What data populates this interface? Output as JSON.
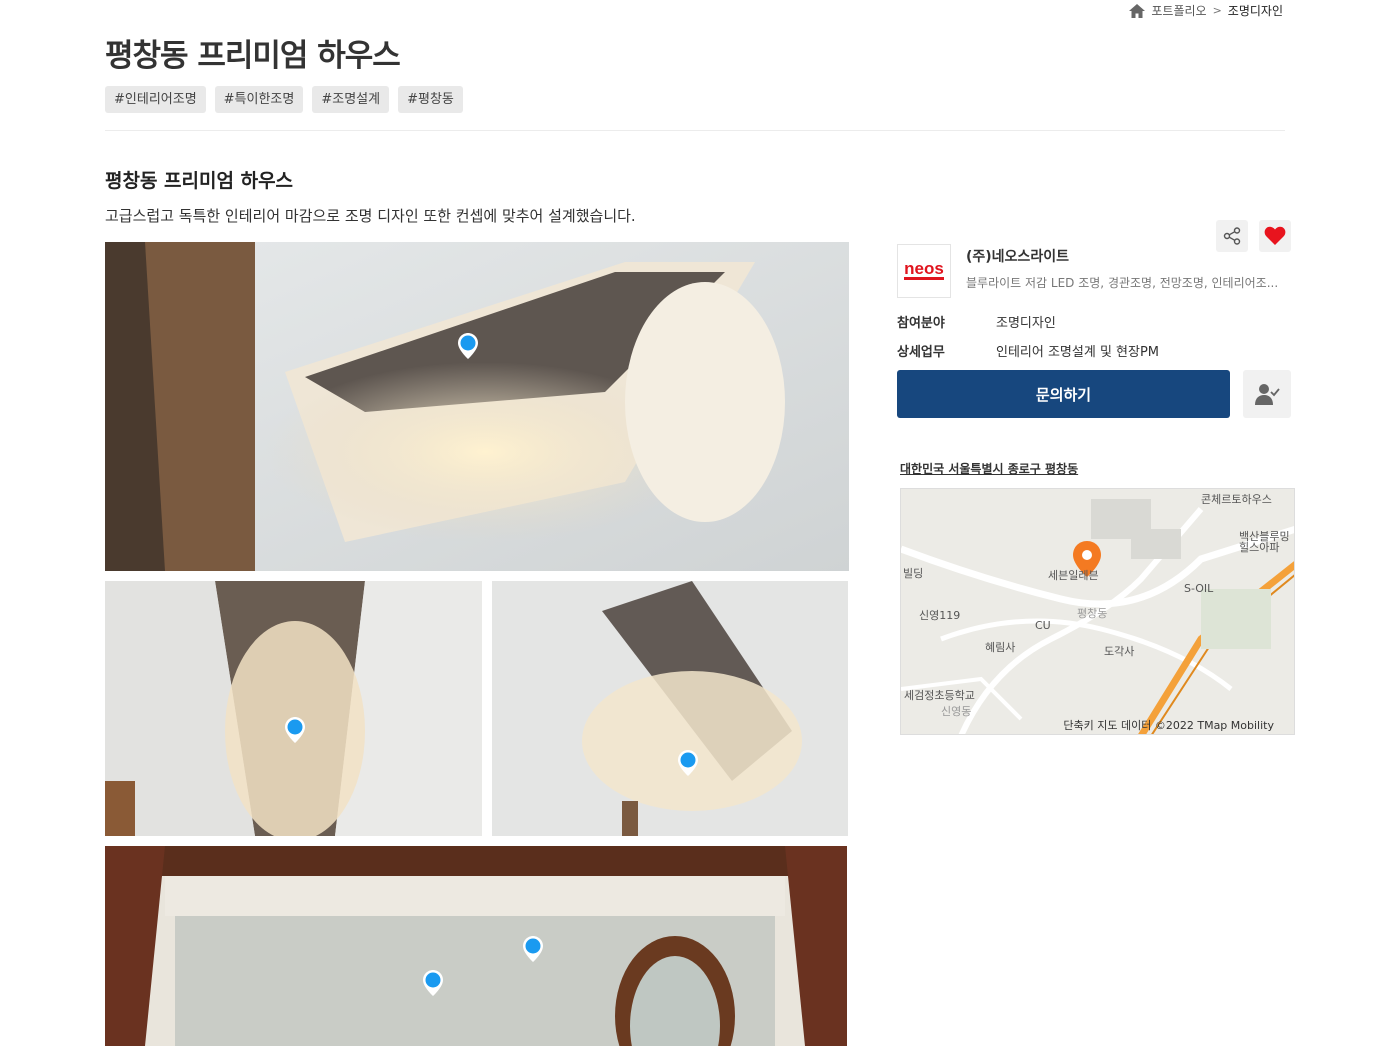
{
  "breadcrumb": {
    "home_icon": "home-icon",
    "parent": "포트폴리오",
    "separator": ">",
    "current": "조명디자인"
  },
  "project": {
    "title": "평창동 프리미엄 하우스",
    "tags": [
      "#인테리어조명",
      "#특이한조명",
      "#조명설계",
      "#평창동"
    ],
    "subtitle": "평창동 프리미엄 하우스",
    "description": "고급스럽고 독특한 인테리어 마감으로 조명 디자인 또한 컨셉에 맞추어 설계했습니다."
  },
  "company": {
    "logo_text": "neos",
    "name": "(주)네오스라이트",
    "description": "블루라이트 저감 LED 조명, 경관조명, 전망조명, 인테리어조...",
    "field_label": "참여분야",
    "field_value": "조명디자인",
    "task_label": "상세업무",
    "task_value": "인테리어 조명설계 및 현장PM",
    "inquiry_button": "문의하기",
    "share_icon": "share-icon",
    "like_icon": "heart-icon",
    "follow_icon": "user-check-icon"
  },
  "map": {
    "address": "대한민국 서울특별시 종로구 평창동",
    "labels": {
      "concerto": "콘체르토하우스",
      "baeksan": "백산블루밍\n힐스아파",
      "building": "빌딩",
      "seven": "세븐일레븐",
      "soil": "S-OIL",
      "sinyoung119": "신영119",
      "cu": "CU",
      "pyeongchang": "평창동",
      "hyerimsa": "혜림사",
      "dogaksa": "도각사",
      "school": "세검정초등학교",
      "sinyoungdong": "신영동"
    },
    "footer": "단축키   지도 데이터 ©2022 TMap Mobility"
  }
}
